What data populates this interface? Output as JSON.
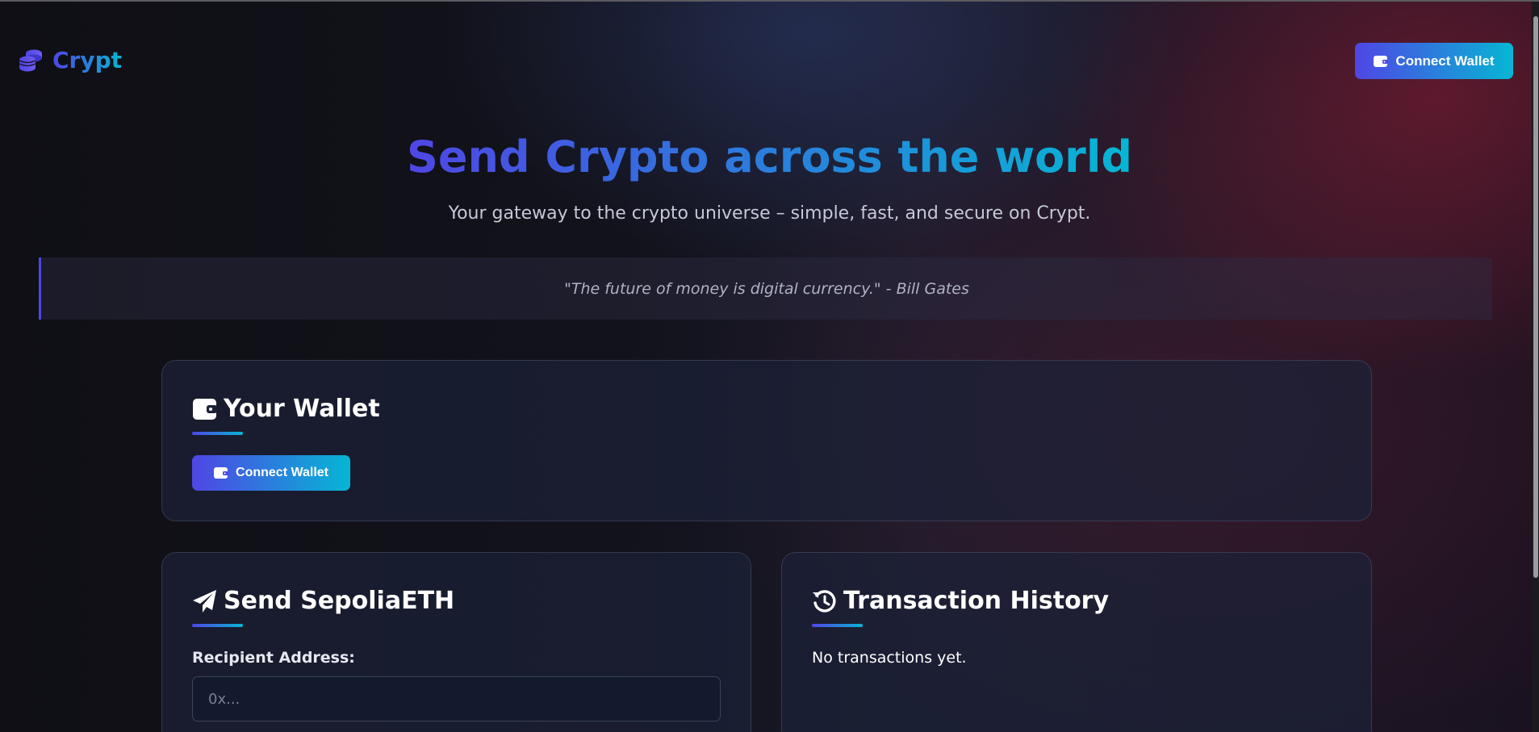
{
  "brand": {
    "name": "Crypt",
    "icon": "coins-icon"
  },
  "header": {
    "connect_label": "Connect Wallet",
    "icon": "wallet-icon"
  },
  "hero": {
    "title": "Send Crypto across the world",
    "subtitle": "Your gateway to the crypto universe – simple, fast, and secure on Crypt.",
    "quote": "\"The future of money is digital currency.\" - Bill Gates"
  },
  "wallet_card": {
    "title": "Your Wallet",
    "icon": "wallet-icon",
    "connect_label": "Connect Wallet"
  },
  "send_card": {
    "title": "Send SepoliaETH",
    "icon": "paper-plane-icon",
    "recipient_label": "Recipient Address:",
    "recipient_placeholder": "0x..."
  },
  "history_card": {
    "title": "Transaction History",
    "icon": "history-icon",
    "empty_text": "No transactions yet."
  },
  "colors": {
    "accent_start": "#4f46e5",
    "accent_end": "#06b6d4",
    "background": "#12121b",
    "card_background": "#1c2137"
  }
}
